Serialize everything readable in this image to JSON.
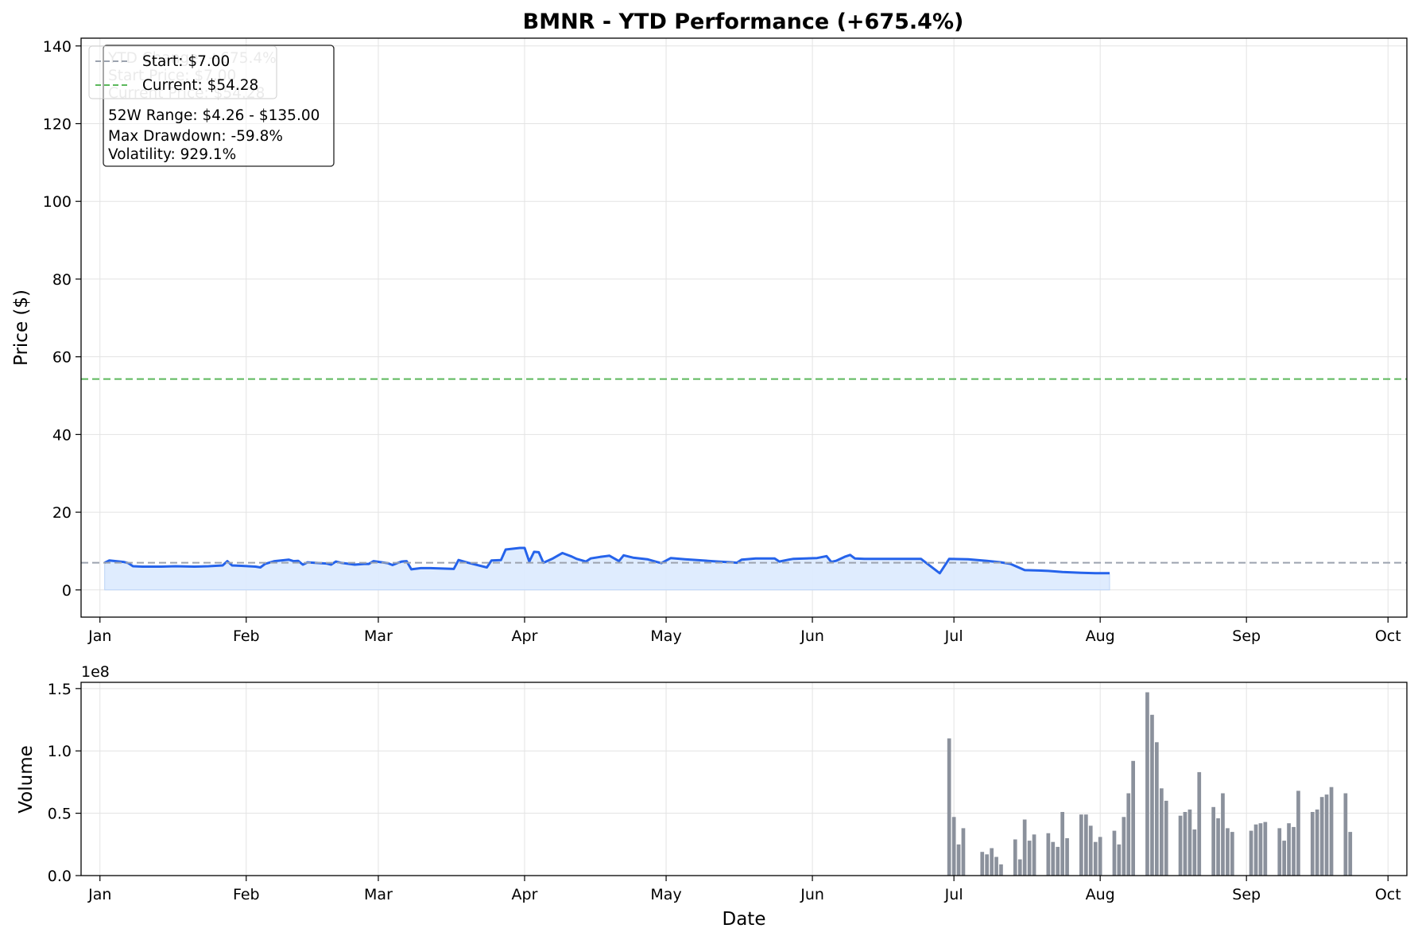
{
  "chart_data": [
    {
      "type": "line",
      "title": "BMNR - YTD Performance (+675.4%)",
      "ylabel": "Price ($)",
      "xlabel": "",
      "ylim": [
        -7,
        142
      ],
      "xlim": [
        "2024-12-28",
        "2025-10-05"
      ],
      "yticks": [
        0,
        20,
        40,
        60,
        80,
        100,
        120,
        140
      ],
      "xticks": [
        {
          "date": "2025-01-01",
          "label": "Jan"
        },
        {
          "date": "2025-02-01",
          "label": "Feb"
        },
        {
          "date": "2025-03-01",
          "label": "Mar"
        },
        {
          "date": "2025-04-01",
          "label": "Apr"
        },
        {
          "date": "2025-05-01",
          "label": "May"
        },
        {
          "date": "2025-06-01",
          "label": "Jun"
        },
        {
          "date": "2025-07-01",
          "label": "Jul"
        },
        {
          "date": "2025-08-01",
          "label": "Aug"
        },
        {
          "date": "2025-09-01",
          "label": "Sep"
        },
        {
          "date": "2025-10-01",
          "label": "Oct"
        }
      ],
      "grid": true,
      "fill_under": true,
      "line_color": "#2563eb",
      "fill_color": "#dbeafe",
      "reference_lines": [
        {
          "label": "Start: $7.00",
          "y": 7.0,
          "color": "#9ca3af",
          "style": "dashed"
        },
        {
          "label": "Current: $54.28",
          "y": 54.28,
          "color": "#5cb85c",
          "style": "dashed"
        }
      ],
      "legend_position": "upper-left",
      "stats_box": {
        "faded_lines": [
          "YTD Change: +675.4%",
          "Start Price: $7.00",
          "Current Price: $54.28"
        ],
        "lines": [
          "52W Range: $4.26 - $135.00",
          "Max Drawdown: -59.8%",
          "Volatility: 929.1%"
        ]
      },
      "series": [
        {
          "values": [
            [
              "2025-01-02",
              7.0
            ],
            [
              "2025-01-03",
              7.6
            ],
            [
              "2025-01-06",
              7.2
            ],
            [
              "2025-01-07",
              6.9
            ],
            [
              "2025-01-08",
              6.1
            ],
            [
              "2025-01-10",
              6.0
            ],
            [
              "2025-01-14",
              6.0
            ],
            [
              "2025-01-17",
              6.1
            ],
            [
              "2025-01-21",
              6.0
            ],
            [
              "2025-01-24",
              6.1
            ],
            [
              "2025-01-27",
              6.3
            ],
            [
              "2025-01-28",
              7.4
            ],
            [
              "2025-01-29",
              6.3
            ],
            [
              "2025-01-31",
              6.2
            ],
            [
              "2025-02-03",
              6.0
            ],
            [
              "2025-02-04",
              5.8
            ],
            [
              "2025-02-05",
              6.7
            ],
            [
              "2025-02-07",
              7.4
            ],
            [
              "2025-02-10",
              7.8
            ],
            [
              "2025-02-11",
              7.4
            ],
            [
              "2025-02-12",
              7.5
            ],
            [
              "2025-02-13",
              6.5
            ],
            [
              "2025-02-14",
              7.1
            ],
            [
              "2025-02-18",
              6.8
            ],
            [
              "2025-02-19",
              6.5
            ],
            [
              "2025-02-20",
              7.3
            ],
            [
              "2025-02-21",
              7.0
            ],
            [
              "2025-02-24",
              6.5
            ],
            [
              "2025-02-26",
              6.7
            ],
            [
              "2025-02-27",
              6.7
            ],
            [
              "2025-02-28",
              7.4
            ],
            [
              "2025-03-03",
              6.9
            ],
            [
              "2025-03-04",
              6.4
            ],
            [
              "2025-03-05",
              6.9
            ],
            [
              "2025-03-06",
              7.3
            ],
            [
              "2025-03-07",
              7.4
            ],
            [
              "2025-03-08",
              5.3
            ],
            [
              "2025-03-10",
              5.6
            ],
            [
              "2025-03-12",
              5.6
            ],
            [
              "2025-03-17",
              5.4
            ],
            [
              "2025-03-18",
              7.7
            ],
            [
              "2025-03-20",
              7.0
            ],
            [
              "2025-03-24",
              5.8
            ],
            [
              "2025-03-25",
              7.6
            ],
            [
              "2025-03-27",
              7.7
            ],
            [
              "2025-03-28",
              10.4
            ],
            [
              "2025-03-31",
              10.8
            ],
            [
              "2025-04-01",
              10.8
            ],
            [
              "2025-04-02",
              7.3
            ],
            [
              "2025-04-03",
              9.8
            ],
            [
              "2025-04-04",
              9.7
            ],
            [
              "2025-04-05",
              7.0
            ],
            [
              "2025-04-07",
              8.1
            ],
            [
              "2025-04-09",
              9.5
            ],
            [
              "2025-04-11",
              8.6
            ],
            [
              "2025-04-12",
              8.0
            ],
            [
              "2025-04-14",
              7.3
            ],
            [
              "2025-04-15",
              8.1
            ],
            [
              "2025-04-17",
              8.5
            ],
            [
              "2025-04-19",
              8.8
            ],
            [
              "2025-04-21",
              7.4
            ],
            [
              "2025-04-22",
              8.9
            ],
            [
              "2025-04-24",
              8.3
            ],
            [
              "2025-04-27",
              7.9
            ],
            [
              "2025-04-29",
              7.2
            ],
            [
              "2025-04-30",
              6.9
            ],
            [
              "2025-05-02",
              8.2
            ],
            [
              "2025-05-05",
              7.9
            ],
            [
              "2025-05-12",
              7.3
            ],
            [
              "2025-05-15",
              7.1
            ],
            [
              "2025-05-16",
              7.0
            ],
            [
              "2025-05-17",
              7.8
            ],
            [
              "2025-05-20",
              8.1
            ],
            [
              "2025-05-24",
              8.1
            ],
            [
              "2025-05-25",
              7.3
            ],
            [
              "2025-05-27",
              7.8
            ],
            [
              "2025-05-28",
              8.0
            ],
            [
              "2025-06-02",
              8.2
            ],
            [
              "2025-06-04",
              8.7
            ],
            [
              "2025-06-05",
              7.2
            ],
            [
              "2025-06-06",
              7.5
            ],
            [
              "2025-06-08",
              8.6
            ],
            [
              "2025-06-09",
              9.0
            ],
            [
              "2025-06-10",
              8.1
            ],
            [
              "2025-06-12",
              8.0
            ],
            [
              "2025-06-16",
              8.0
            ],
            [
              "2025-06-24",
              8.0
            ],
            [
              "2025-06-30",
              8.0
            ],
            [
              "2025-07-04",
              7.9
            ],
            [
              "2025-07-08",
              7.5
            ],
            [
              "2025-07-11",
              7.1
            ],
            [
              "2025-07-13",
              6.7
            ],
            [
              "2025-07-16",
              5.1
            ],
            [
              "2025-07-19",
              5.0
            ],
            [
              "2025-07-21",
              4.9
            ],
            [
              "2025-07-24",
              4.6
            ],
            [
              "2025-07-28",
              4.4
            ],
            [
              "2025-07-31",
              4.3
            ],
            [
              "2025-08-03",
              4.3
            ],
            [
              "2025-06-28",
              4.3
            ]
          ]
        }
      ]
    },
    {
      "type": "bar",
      "title": "",
      "xlabel": "Date",
      "ylabel": "Volume",
      "y_offset_label": "1e8",
      "ylim": [
        0,
        1.55
      ],
      "yticks": [
        "0.0",
        "0.5",
        "1.0",
        "1.5"
      ],
      "xlim": [
        "2024-12-28",
        "2025-10-05"
      ],
      "grid": true,
      "bar_color": "#8b919c",
      "series": [
        {
          "values": [
            [
              "2025-06-30",
              1.1
            ],
            [
              "2025-07-01",
              0.47
            ],
            [
              "2025-07-02",
              0.25
            ],
            [
              "2025-07-03",
              0.38
            ],
            [
              "2025-07-07",
              0.19
            ],
            [
              "2025-07-08",
              0.17
            ],
            [
              "2025-07-09",
              0.22
            ],
            [
              "2025-07-10",
              0.15
            ],
            [
              "2025-07-11",
              0.09
            ],
            [
              "2025-07-14",
              0.29
            ],
            [
              "2025-07-15",
              0.13
            ],
            [
              "2025-07-16",
              0.45
            ],
            [
              "2025-07-17",
              0.28
            ],
            [
              "2025-07-18",
              0.33
            ],
            [
              "2025-07-21",
              0.34
            ],
            [
              "2025-07-22",
              0.27
            ],
            [
              "2025-07-23",
              0.23
            ],
            [
              "2025-07-24",
              0.51
            ],
            [
              "2025-07-25",
              0.3
            ],
            [
              "2025-07-28",
              0.49
            ],
            [
              "2025-07-29",
              0.49
            ],
            [
              "2025-07-30",
              0.4
            ],
            [
              "2025-07-31",
              0.27
            ],
            [
              "2025-08-01",
              0.31
            ],
            [
              "2025-08-04",
              0.36
            ],
            [
              "2025-08-05",
              0.25
            ],
            [
              "2025-08-06",
              0.47
            ],
            [
              "2025-08-07",
              0.66
            ],
            [
              "2025-08-08",
              0.92
            ],
            [
              "2025-08-11",
              1.47
            ],
            [
              "2025-08-12",
              1.29
            ],
            [
              "2025-08-13",
              1.07
            ],
            [
              "2025-08-14",
              0.7
            ],
            [
              "2025-08-15",
              0.6
            ],
            [
              "2025-08-18",
              0.48
            ],
            [
              "2025-08-19",
              0.51
            ],
            [
              "2025-08-20",
              0.53
            ],
            [
              "2025-08-21",
              0.37
            ],
            [
              "2025-08-22",
              0.83
            ],
            [
              "2025-08-25",
              0.55
            ],
            [
              "2025-08-26",
              0.46
            ],
            [
              "2025-08-27",
              0.66
            ],
            [
              "2025-08-28",
              0.38
            ],
            [
              "2025-08-29",
              0.35
            ],
            [
              "2025-09-02",
              0.36
            ],
            [
              "2025-09-03",
              0.41
            ],
            [
              "2025-09-04",
              0.42
            ],
            [
              "2025-09-05",
              0.43
            ],
            [
              "2025-09-08",
              0.38
            ],
            [
              "2025-09-09",
              0.28
            ],
            [
              "2025-09-10",
              0.42
            ],
            [
              "2025-09-11",
              0.39
            ],
            [
              "2025-09-12",
              0.68
            ],
            [
              "2025-09-15",
              0.51
            ],
            [
              "2025-09-16",
              0.53
            ],
            [
              "2025-09-17",
              0.63
            ],
            [
              "2025-09-18",
              0.65
            ],
            [
              "2025-09-19",
              0.71
            ],
            [
              "2025-09-22",
              0.66
            ],
            [
              "2025-09-23",
              0.35
            ]
          ]
        }
      ]
    }
  ]
}
